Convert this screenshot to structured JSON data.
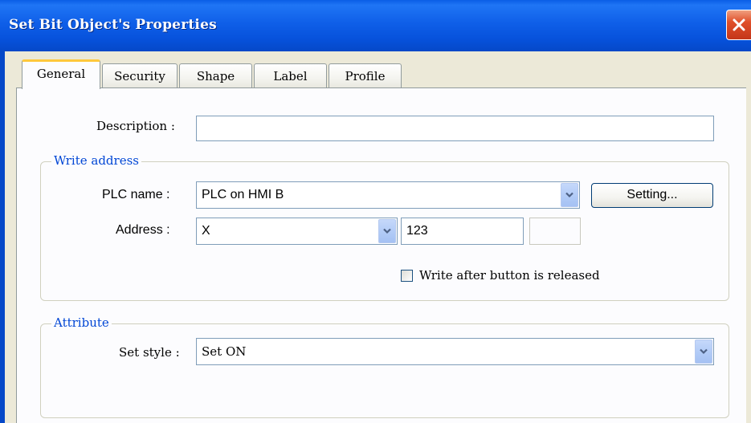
{
  "window": {
    "title": "Set Bit Object's Properties"
  },
  "tabs": [
    {
      "label": "General"
    },
    {
      "label": "Security"
    },
    {
      "label": "Shape"
    },
    {
      "label": "Label"
    },
    {
      "label": "Profile"
    }
  ],
  "general": {
    "description_label": "Description :",
    "description_value": "",
    "write_address": {
      "title": "Write address",
      "plc_name_label": "PLC name :",
      "plc_name_value": "PLC on HMI B",
      "setting_button": "Setting...",
      "address_label": "Address :",
      "address_device": "X",
      "address_value": "123",
      "address_suffix": "",
      "write_after_release_label": "Write after button is released",
      "write_after_release_checked": false
    },
    "attribute": {
      "title": "Attribute",
      "set_style_label": "Set style :",
      "set_style_value": "Set ON"
    }
  },
  "colors": {
    "titlebar": "#0752dc",
    "group_title": "#0046d5",
    "active_tab_highlight": "#ffc83c",
    "close_button": "#e0502a"
  }
}
